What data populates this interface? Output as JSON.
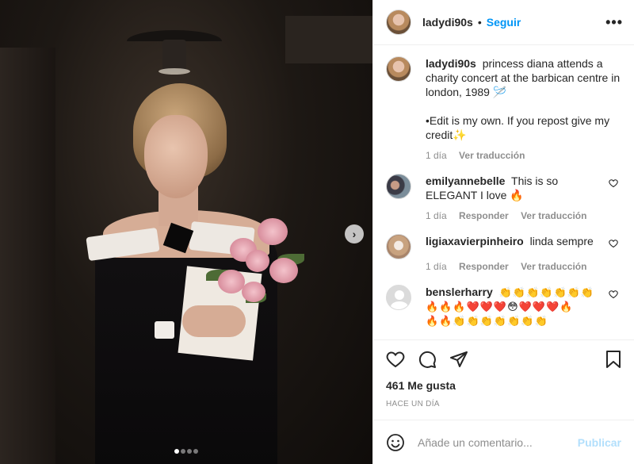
{
  "post": {
    "username": "ladydi90s",
    "follow_label": "Seguir",
    "separator": "•",
    "more_label": "•••"
  },
  "carousel": {
    "slide_count": 4,
    "active_index": 0,
    "next_label": "›"
  },
  "caption": {
    "username": "ladydi90s",
    "text": "princess diana attends a charity concert at the barbican centre in london, 1989 🪡",
    "text2": "•Edit is my own. If you repost give my credit✨",
    "age": "1 día",
    "translate_label": "Ver traducción"
  },
  "comments": [
    {
      "username": "emilyannebelle",
      "text": "This is so ELEGANT I love 🔥",
      "age": "1 día",
      "reply_label": "Responder",
      "translate_label": "Ver traducción"
    },
    {
      "username": "ligiaxavierpinheiro",
      "text": "linda sempre",
      "age": "1 día",
      "reply_label": "Responder",
      "translate_label": "Ver traducción"
    },
    {
      "username": "benslerharry",
      "text": "👏👏👏👏👏👏👏",
      "text2": "🔥🔥🔥❤️❤️❤️😳❤️❤️❤️🔥",
      "text3": "🔥🔥👏👏👏👏👏👏👏"
    }
  ],
  "likes_text": "461 Me gusta",
  "timestamp": "HACE UN DÍA",
  "composer": {
    "placeholder": "Añade un comentario...",
    "publish_label": "Publicar"
  },
  "colors": {
    "accent": "#0095f6",
    "publish_disabled": "#b2dffc",
    "muted": "#8e8e8e"
  }
}
